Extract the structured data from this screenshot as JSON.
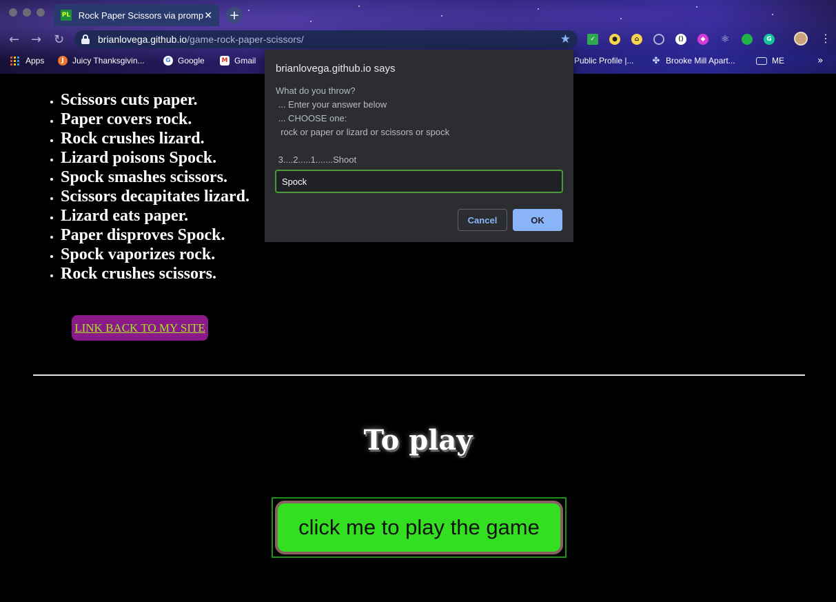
{
  "browser": {
    "tab": {
      "favicon_text": "PL",
      "title": "Rock Paper Scissors via promp",
      "close": "✕"
    },
    "new_tab": "+",
    "address": {
      "host": "brianlovega.github.io",
      "path": "/game-rock-paper-scissors/"
    },
    "bookmarks": [
      {
        "label": "Apps",
        "icon": "apps-grid-icon"
      },
      {
        "label": "Juicy Thanksgivin...",
        "icon": "juicy-favicon"
      },
      {
        "label": "Google",
        "icon": "google-favicon"
      },
      {
        "label": "Gmail",
        "icon": "gmail-favicon"
      },
      {
        "label": "Public Profile |...",
        "icon": "page-favicon"
      },
      {
        "label": "Brooke Mill Apart...",
        "icon": "building-favicon"
      },
      {
        "label": "ME",
        "icon": "folder-icon"
      }
    ],
    "more": "»"
  },
  "page": {
    "rules": [
      "Scissors cuts paper.",
      "Paper covers rock.",
      "Rock crushes lizard.",
      "Lizard poisons Spock.",
      "Spock smashes scissors.",
      "Scissors decapitates lizard.",
      "Lizard eats paper.",
      "Paper disproves Spock.",
      "Spock vaporizes rock.",
      "Rock crushes scissors."
    ],
    "link_label": "LINK BACK TO MY SITE",
    "to_play": "To play",
    "play_button": "click me to play the game"
  },
  "dialog": {
    "title": "brianlovega.github.io says",
    "message": "What do you throw?\n ... Enter your answer below\n ... CHOOSE one:\n  rock or paper or lizard or scissors or spock\n\n 3....2.....1.......Shoot",
    "input_value": "Spock",
    "cancel": "Cancel",
    "ok": "OK"
  },
  "colors": {
    "page_bg": "#000000",
    "link_bg": "#8a1a8a",
    "link_text": "#a8e61d",
    "play_button_bg": "#33e021",
    "dialog_bg": "#2b2d31",
    "dialog_accent": "#8ab4f8"
  }
}
